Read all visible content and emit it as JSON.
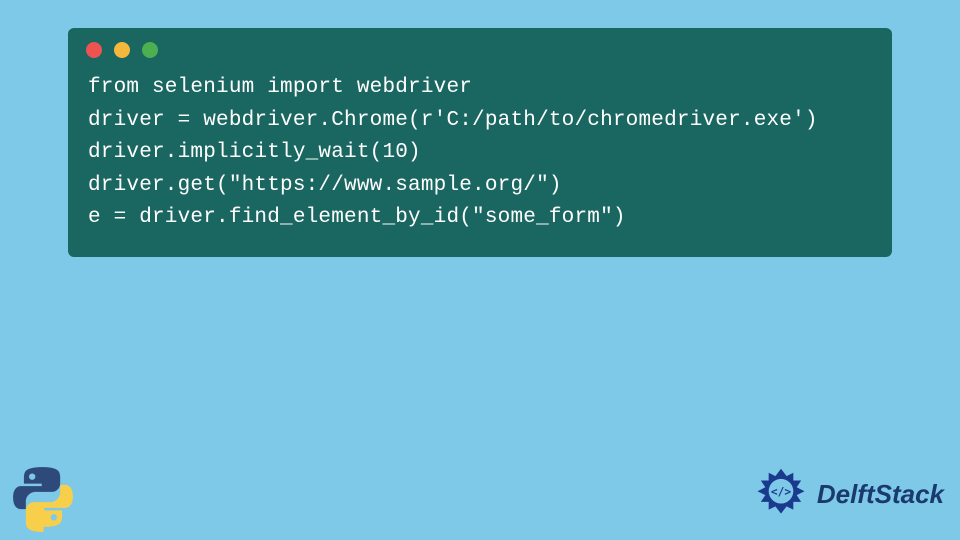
{
  "code": {
    "lines": [
      "from selenium import webdriver",
      "driver = webdriver.Chrome(r'C:/path/to/chromedriver.exe')",
      "driver.implicitly_wait(10)",
      "driver.get(\"https://www.sample.org/\")",
      "e = driver.find_element_by_id(\"some_form\")"
    ]
  },
  "brand": {
    "name": "DelftStack"
  }
}
